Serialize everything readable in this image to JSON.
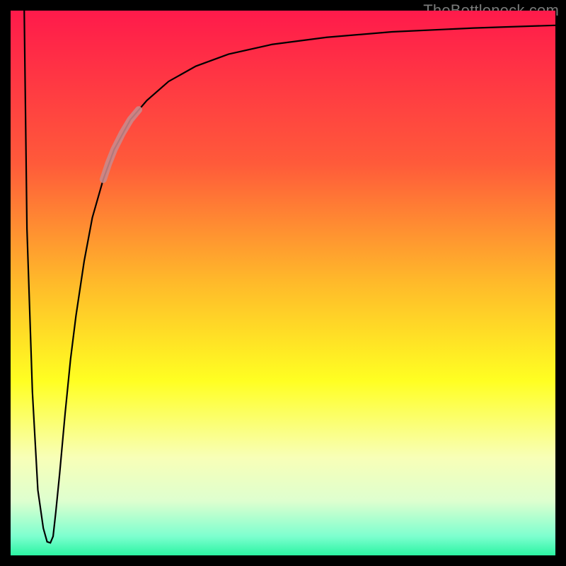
{
  "watermark": "TheBottleneck.com",
  "chart_data": {
    "type": "line",
    "title": "",
    "xlabel": "",
    "ylabel": "",
    "xlim": [
      0,
      100
    ],
    "ylim": [
      0,
      100
    ],
    "grid": false,
    "legend": false,
    "background_gradient": {
      "stops": [
        {
          "offset": 0.0,
          "color": "#ff1a4b"
        },
        {
          "offset": 0.28,
          "color": "#ff5a3a"
        },
        {
          "offset": 0.5,
          "color": "#ffba2a"
        },
        {
          "offset": 0.68,
          "color": "#ffff22"
        },
        {
          "offset": 0.82,
          "color": "#f8ffb7"
        },
        {
          "offset": 0.9,
          "color": "#deffcf"
        },
        {
          "offset": 0.965,
          "color": "#7dffcf"
        },
        {
          "offset": 1.0,
          "color": "#2bf4a3"
        }
      ]
    },
    "series": [
      {
        "name": "bottleneck-curve",
        "stroke": "#000000",
        "stroke_width": 2.2,
        "x": [
          2.5,
          3.0,
          4.0,
          5.0,
          6.0,
          6.7,
          7.3,
          7.8,
          8.3,
          9.0,
          10.0,
          11.0,
          12.0,
          13.5,
          15.0,
          17.0,
          19.0,
          22.0,
          25.0,
          29.0,
          34.0,
          40.0,
          48.0,
          58.0,
          70.0,
          85.0,
          100.0
        ],
        "y": [
          100.0,
          60.0,
          30.0,
          12.0,
          5.0,
          2.5,
          2.3,
          3.5,
          8.0,
          15.0,
          26.0,
          36.0,
          44.0,
          54.0,
          62.0,
          69.0,
          74.5,
          80.0,
          83.5,
          87.0,
          89.8,
          92.0,
          93.8,
          95.1,
          96.1,
          96.8,
          97.3
        ]
      }
    ],
    "highlight_segment": {
      "name": "highlight-band",
      "stroke": "#c98a8c",
      "stroke_width": 10,
      "opacity": 0.88,
      "x": [
        17.0,
        18.0,
        19.0,
        20.5,
        22.0,
        23.5
      ],
      "y": [
        69.0,
        72.0,
        74.5,
        77.5,
        80.0,
        81.8
      ]
    }
  }
}
